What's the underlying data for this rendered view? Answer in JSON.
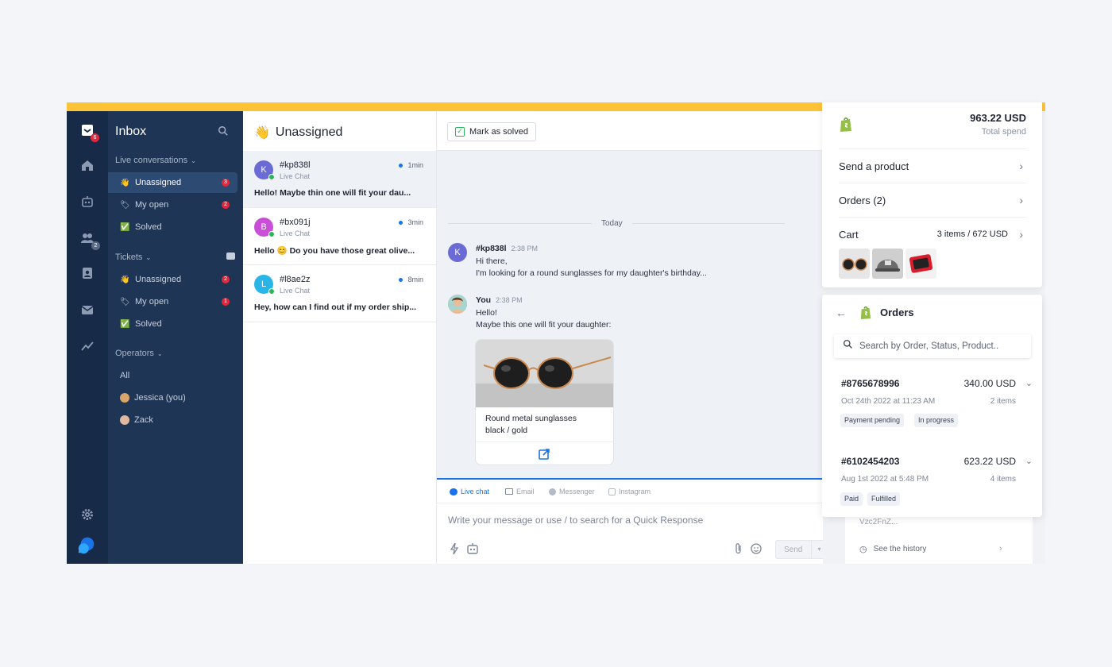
{
  "colors": {
    "accent": "#1a73e8",
    "rail": "#172a47",
    "sidebar": "#1f3556",
    "badge": "#e5263b",
    "online": "#2ab55b",
    "frame": "#fcc336"
  },
  "rail": {
    "inbox_badge": "6",
    "team_badge": "2",
    "icons": [
      "inbox-icon",
      "home-icon",
      "bot-icon",
      "team-icon",
      "contacts-icon",
      "campaigns-icon",
      "analytics-icon",
      "settings-icon",
      "logo-icon"
    ]
  },
  "sidebar": {
    "title": "Inbox",
    "live_conversations": {
      "label": "Live conversations",
      "items": [
        {
          "label": "Unassigned",
          "emoji": "👋",
          "badge": "3"
        },
        {
          "label": "My open",
          "emoji": "🏷",
          "badge": "2"
        },
        {
          "label": "Solved",
          "emoji": "✅",
          "badge": ""
        }
      ]
    },
    "tickets": {
      "label": "Tickets",
      "items": [
        {
          "label": "Unassigned",
          "emoji": "👋",
          "badge": "2"
        },
        {
          "label": "My open",
          "emoji": "🏷",
          "badge": "1"
        },
        {
          "label": "Solved",
          "emoji": "✅",
          "badge": ""
        }
      ]
    },
    "operators": {
      "label": "Operators",
      "items": [
        {
          "label": "All"
        },
        {
          "label": "Jessica (you)"
        },
        {
          "label": "Zack"
        }
      ]
    }
  },
  "conversations": {
    "header": "Unassigned",
    "header_emoji": "👋",
    "items": [
      {
        "initial": "K",
        "id": "#kp838l",
        "channel": "Live Chat",
        "time": "1min",
        "preview": "Hello! Maybe thin one will fit your dau...",
        "color": "#6b6bd6"
      },
      {
        "initial": "B",
        "id": "#bx091j",
        "channel": "Live Chat",
        "time": "3min",
        "preview": "Hello 😊 Do you have those great olive...",
        "color": "#c94fd6"
      },
      {
        "initial": "L",
        "id": "#l8ae2z",
        "channel": "Live Chat",
        "time": "8min",
        "preview": "Hey, how can I find out if my order ship...",
        "color": "#2ab5e8"
      }
    ]
  },
  "chat": {
    "mark_solved": "Mark as solved",
    "today": "Today",
    "messages": [
      {
        "initial": "K",
        "author": "#kp838l",
        "time": "2:38 PM",
        "lines": [
          "Hi there,",
          "I'm looking for a round sunglasses for my daughter's birthday..."
        ]
      },
      {
        "author": "You",
        "time": "2:38 PM",
        "lines": [
          "Hello!",
          "Maybe this one will fit your daughter:"
        ]
      }
    ],
    "product": {
      "name": "Round metal sunglasses",
      "variant": "black / gold"
    },
    "composer": {
      "tabs": [
        "Live chat",
        "Email",
        "Messenger",
        "Instagram"
      ],
      "placeholder": "Write your message or use / to search for a Quick Response",
      "send": "Send"
    }
  },
  "customer": {
    "total_spend": "963.22 USD",
    "total_spend_label": "Total spend",
    "send_product": "Send a product",
    "orders_row": "Orders (2)",
    "cart_label": "Cart",
    "cart_summary": "3 items / 672 USD"
  },
  "orders_panel": {
    "title": "Orders",
    "search_placeholder": "Search by Order, Status, Product..",
    "orders": [
      {
        "id": "#8765678996",
        "amount": "340.00 USD",
        "date": "Oct 24th 2022 at 11:23 AM",
        "items": "2 items",
        "tags": [
          "Payment pending",
          "In progress"
        ]
      },
      {
        "id": "#6102454203",
        "amount": "623.22 USD",
        "date": "Aug 1st 2022 at 5:48 PM",
        "items": "4 items",
        "tags": [
          "Paid",
          "Fulfilled"
        ]
      }
    ]
  },
  "history_peek": {
    "text": "Vzc2FnZ...",
    "see_history": "See the history"
  }
}
